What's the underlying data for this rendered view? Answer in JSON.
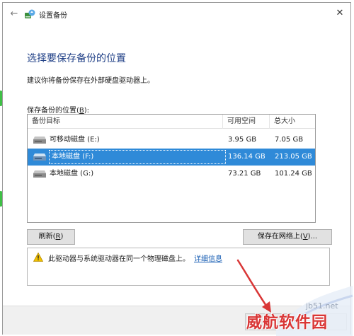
{
  "window": {
    "title": "设置备份",
    "back_glyph": "←",
    "close_glyph": "✕"
  },
  "page": {
    "heading": "选择要保存备份的位置",
    "description": "建议你将备份保存在外部硬盘驱动器上。",
    "list_label_prefix": "保存备份的位置(",
    "list_label_key": "B",
    "list_label_suffix": "):"
  },
  "list": {
    "columns": [
      "备份目标",
      "可用空间",
      "总大小"
    ],
    "rows": [
      {
        "name": "可移动磁盘 (E:)",
        "free": "3.95 GB",
        "total": "7.05 GB",
        "selected": false
      },
      {
        "name": "本地磁盘 (F:)",
        "free": "136.14 GB",
        "total": "213.05 GB",
        "selected": true
      },
      {
        "name": "本地磁盘 (G:)",
        "free": "73.21 GB",
        "total": "101.24 GB",
        "selected": false
      }
    ]
  },
  "buttons": {
    "refresh_prefix": "刷新(",
    "refresh_key": "R",
    "refresh_suffix": ")",
    "save_network_prefix": "保存在网络上(",
    "save_network_key": "V",
    "save_network_suffix": ")..."
  },
  "warning": {
    "text": "此驱动器与系统驱动器在同一个物理磁盘上。",
    "link": "详细信息"
  },
  "watermark": {
    "site": "jb51.net",
    "brand": "威航软件园"
  },
  "colors": {
    "accent": "#2f8ad8",
    "heading": "#1f3f86",
    "link": "#1a5fb4",
    "watermark_red": "#d93636"
  }
}
